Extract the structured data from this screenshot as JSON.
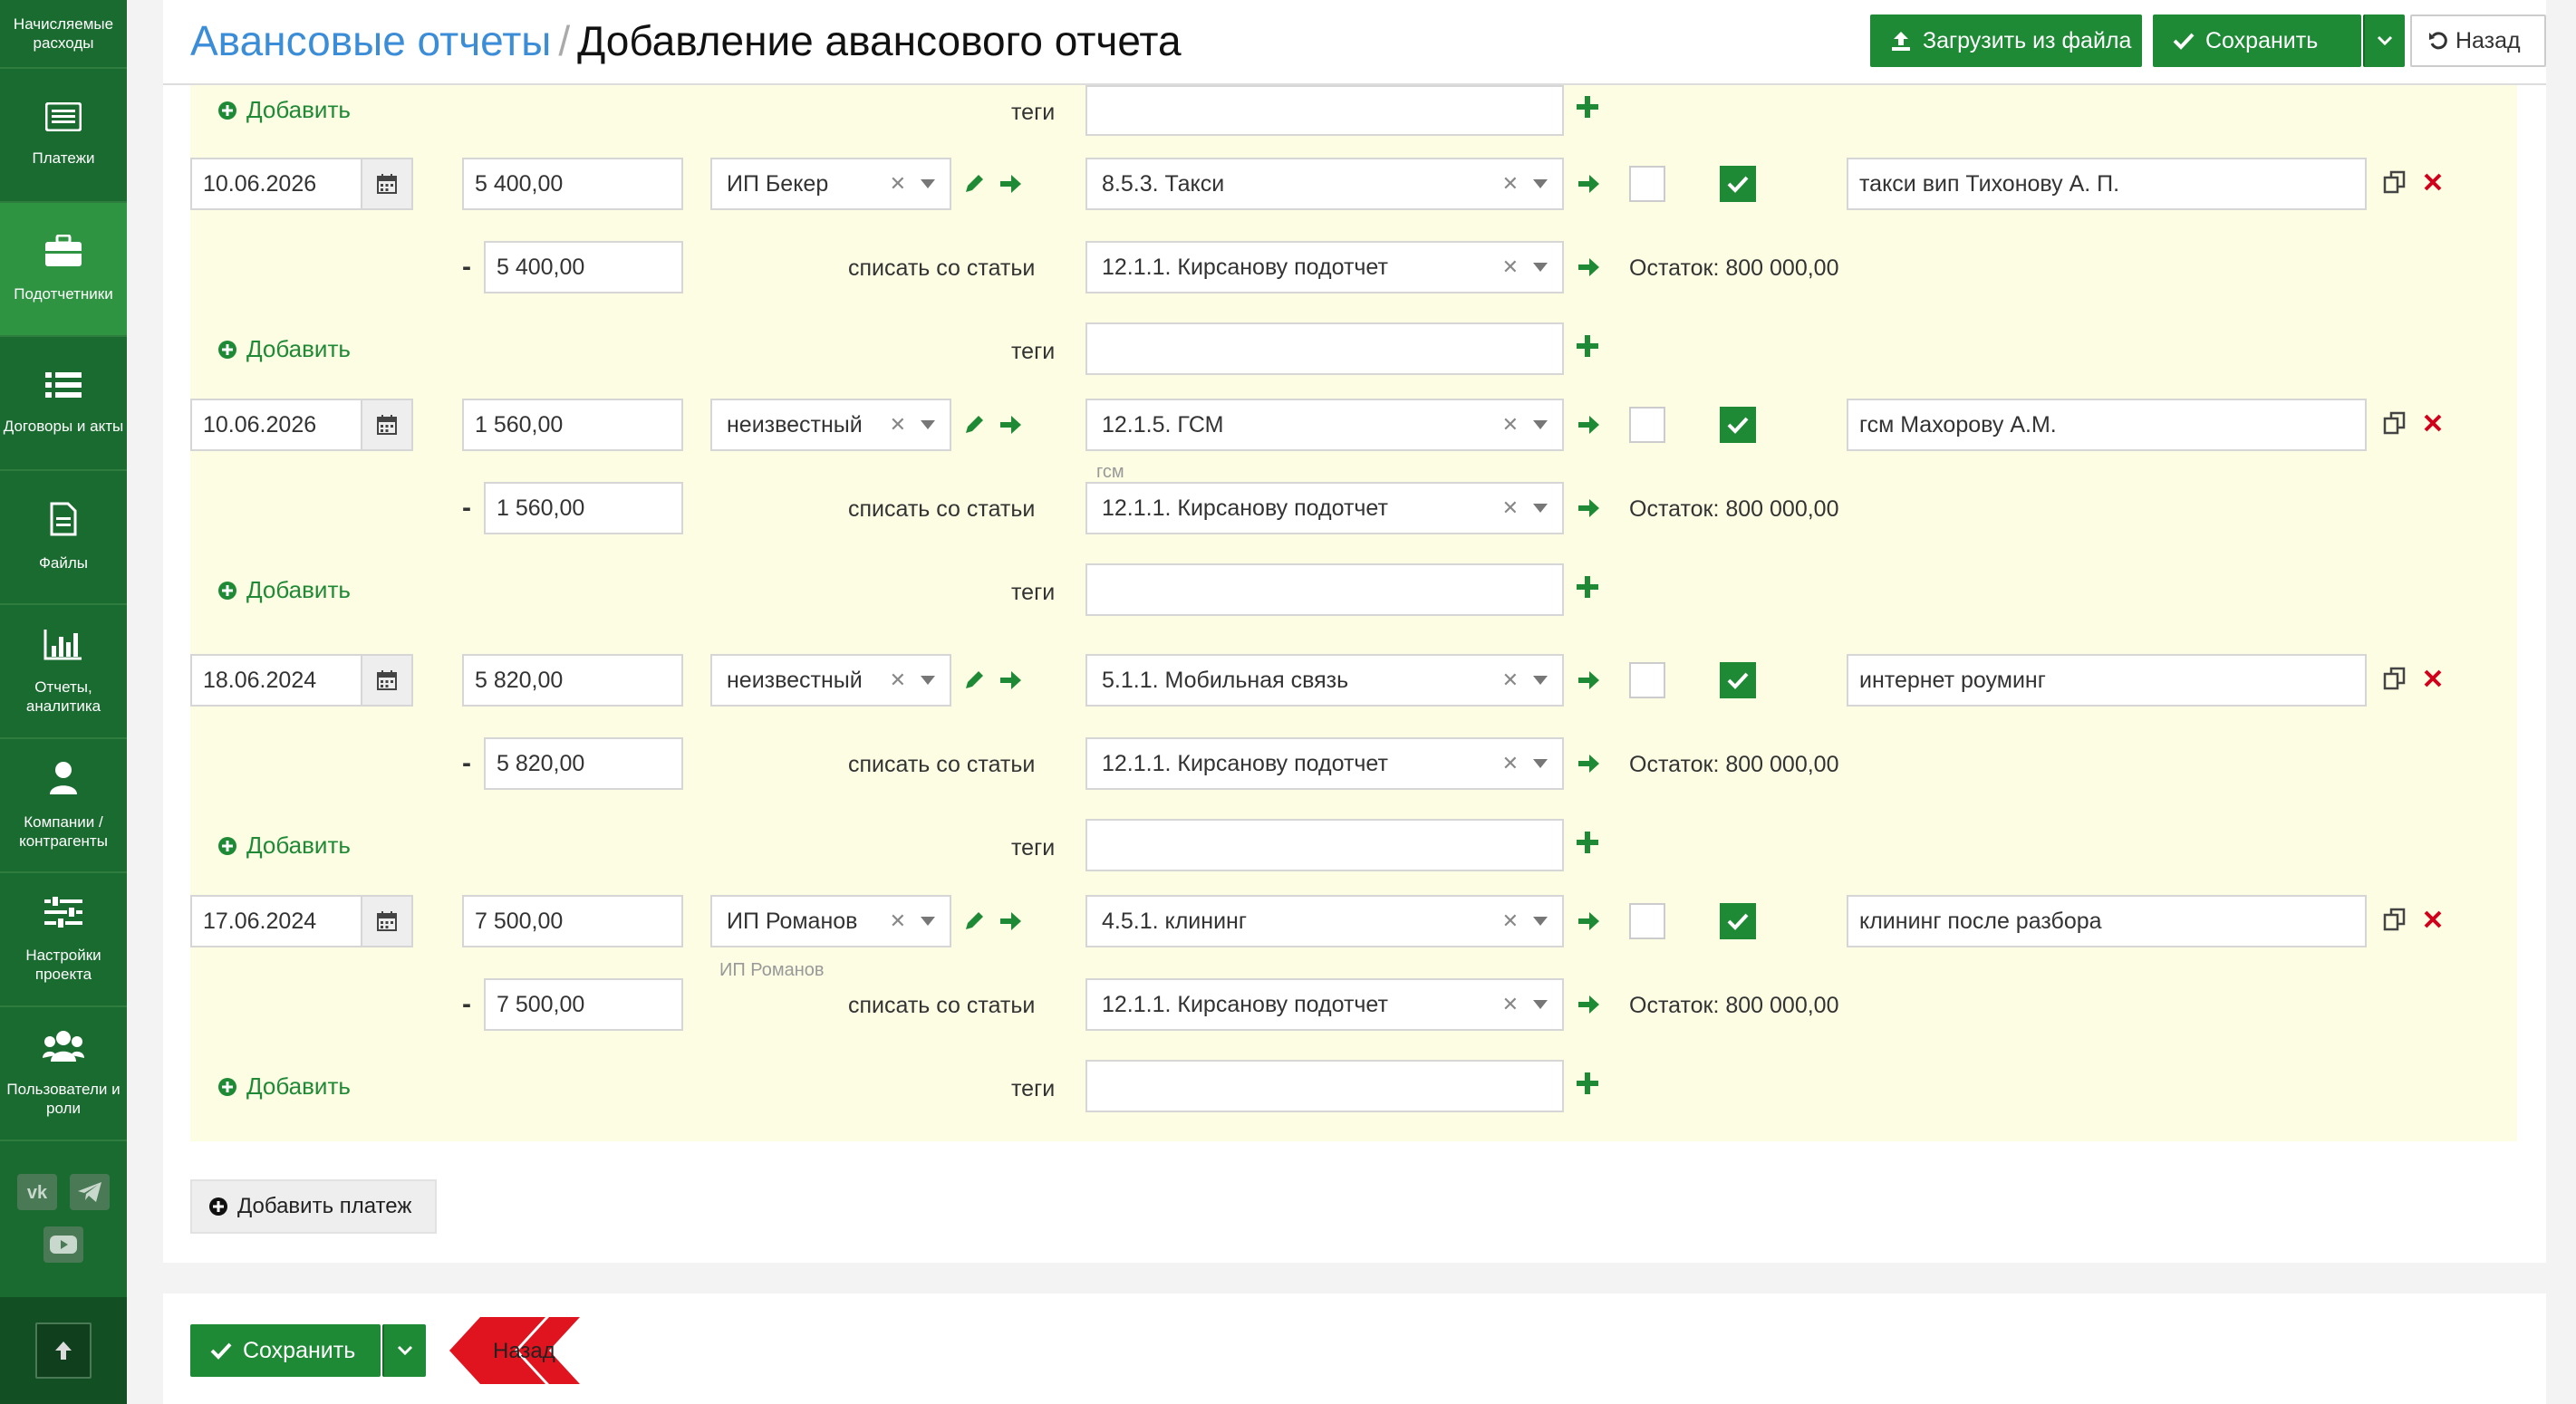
{
  "sidebar": {
    "items": [
      {
        "label": "Начисляемые расходы"
      },
      {
        "label": "Платежи"
      },
      {
        "label": "Подотчетники"
      },
      {
        "label": "Договоры и акты"
      },
      {
        "label": "Файлы"
      },
      {
        "label": "Отчеты, аналитика"
      },
      {
        "label": "Компании / контрагенты"
      },
      {
        "label": "Настройки проекта"
      },
      {
        "label": "Пользователи и роли"
      }
    ]
  },
  "header": {
    "crumb_parent": "Авансовые отчеты",
    "crumb_sep": "/",
    "title": "Добавление авансового отчета",
    "upload_label": "Загрузить из файла",
    "save_label": "Сохранить",
    "back_label": "Назад"
  },
  "common": {
    "add_label": "Добавить",
    "tags_label": "теги",
    "writeoff_label": "списать со статьи",
    "dash": "-"
  },
  "rows": [
    {
      "date": "10.06.2026",
      "amount": "5 400,00",
      "counterparty": "ИП Бекер",
      "counterparty_hint": "",
      "article": "8.5.3. Такси",
      "article_hint": "",
      "comment": "такси вип Тихонову А. П.",
      "writeoff_amount": "5 400,00",
      "writeoff_article": "12.1.1. Кирсанову подотчет",
      "balance": "Остаток: 800 000,00"
    },
    {
      "date": "10.06.2026",
      "amount": "1 560,00",
      "counterparty": "неизвестный",
      "counterparty_hint": "",
      "article": "12.1.5. ГСМ",
      "article_hint": "гсм",
      "comment": "гсм Махорову А.М.",
      "writeoff_amount": "1 560,00",
      "writeoff_article": "12.1.1. Кирсанову подотчет",
      "balance": "Остаток: 800 000,00"
    },
    {
      "date": "18.06.2024",
      "amount": "5 820,00",
      "counterparty": "неизвестный",
      "counterparty_hint": "",
      "article": "5.1.1. Мобильная связь",
      "article_hint": "",
      "comment": "интернет роуминг",
      "writeoff_amount": "5 820,00",
      "writeoff_article": "12.1.1. Кирсанову подотчет",
      "balance": "Остаток: 800 000,00"
    },
    {
      "date": "17.06.2024",
      "amount": "7 500,00",
      "counterparty": "ИП Романов",
      "counterparty_hint": "ИП Романов",
      "article": "4.5.1. клининг",
      "article_hint": "",
      "comment": "клининг после разбора",
      "writeoff_amount": "7 500,00",
      "writeoff_article": "12.1.1. Кирсанову подотчет",
      "balance": "Остаток: 800 000,00"
    }
  ],
  "add_payment_label": "Добавить платеж",
  "footer": {
    "save_label": "Сохранить",
    "back_label": "Назад"
  },
  "colors": {
    "sidebar": "#1a6b30",
    "accent": "#1f8a36",
    "link": "#3c8dd8",
    "row_bg": "#fdfde3",
    "delete": "#d0021b"
  }
}
